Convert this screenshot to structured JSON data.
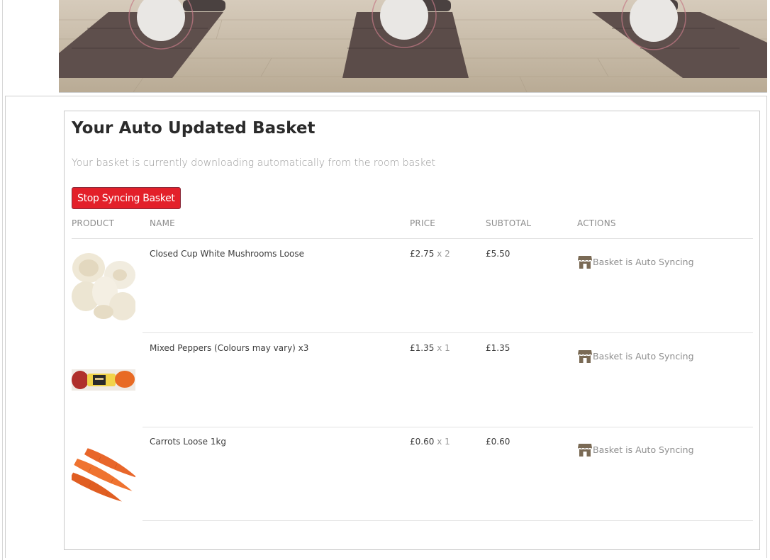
{
  "basket": {
    "title": "Your Auto Updated Basket",
    "subtitle": "Your basket is currently downloading automatically from the room basket",
    "stop_button_label": "Stop Syncing Basket"
  },
  "table": {
    "headers": [
      "PRODUCT",
      "NAME",
      "PRICE",
      "SUBTOTAL",
      "ACTIONS"
    ],
    "rows": [
      {
        "image": "mushrooms",
        "name": "Closed Cup White Mushrooms Loose",
        "price": "£2.75",
        "qty": "x 2",
        "subtotal": "£5.50",
        "action_icon": "store-icon",
        "action_label": "Basket is Auto Syncing"
      },
      {
        "image": "peppers",
        "name": "Mixed Peppers (Colours may vary) x3",
        "price": "£1.35",
        "qty": "x 1",
        "subtotal": "£1.35",
        "action_icon": "store-icon",
        "action_label": "Basket is Auto Syncing"
      },
      {
        "image": "carrots",
        "name": "Carrots Loose 1kg",
        "price": "£0.60",
        "qty": "x 1",
        "subtotal": "£0.60",
        "action_icon": "store-icon",
        "action_label": "Basket is Auto Syncing"
      }
    ]
  },
  "colors": {
    "accent_red": "#e3202a",
    "store_icon": "#7a6a55",
    "muted_text": "#9a9a9a"
  }
}
